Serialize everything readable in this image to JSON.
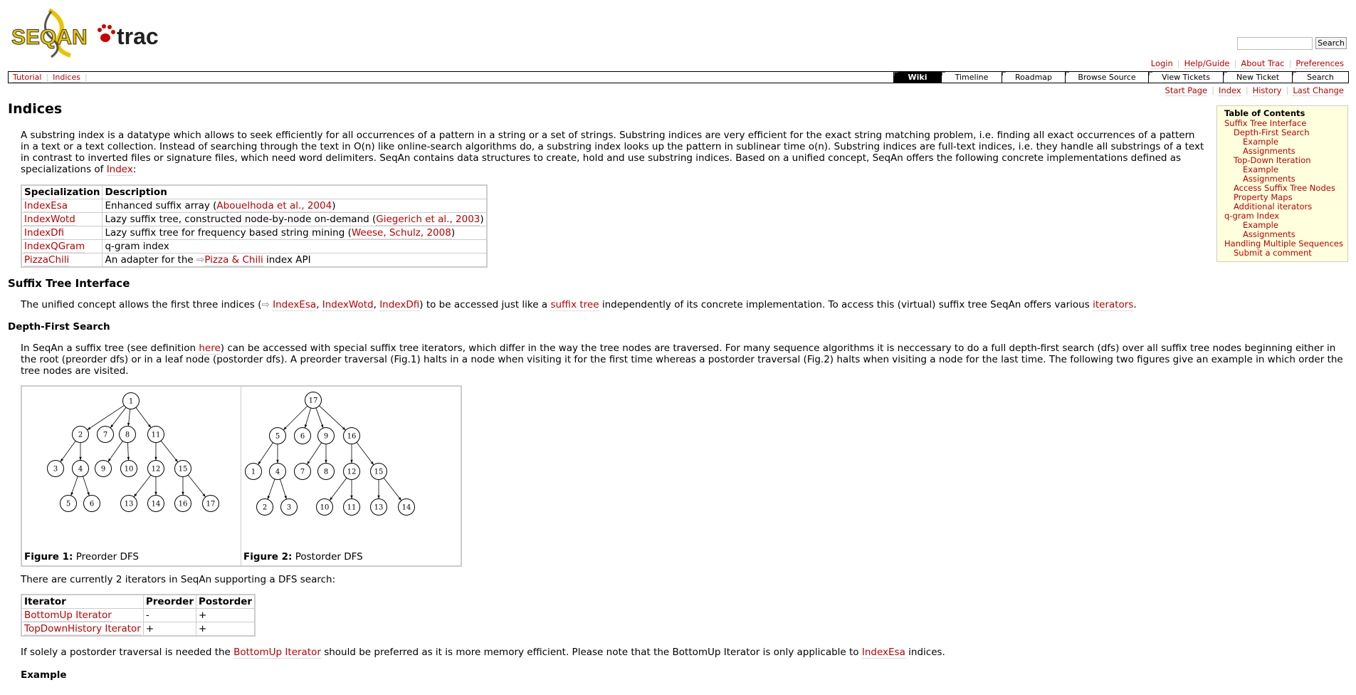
{
  "header": {
    "logo_text_seqan": "SEQAN",
    "logo_text_trac": "trac",
    "search_button": "Search"
  },
  "metanav": [
    "Login",
    "Help/Guide",
    "About Trac",
    "Preferences"
  ],
  "mainnav": {
    "left_links": [
      "Tutorial",
      "Indices"
    ],
    "tabs": [
      "Wiki",
      "Timeline",
      "Roadmap",
      "Browse Source",
      "View Tickets",
      "New Ticket",
      "Search"
    ],
    "active_tab": "Wiki"
  },
  "ctxnav": [
    "Start Page",
    "Index",
    "History",
    "Last Change"
  ],
  "page": {
    "title": "Indices",
    "intro_text": "A substring index is a datatype which allows to seek efficiently for all occurrences of a pattern in a string or a set of strings. Substring indices are very efficient for the exact string matching problem, i.e. finding all exact occurrences of a pattern in a text or a text collection. Instead of searching through the text in O(n) like online-search algorithms do, a substring index looks up the pattern in sublinear time o(n). Substring indices are full-text indices, i.e. they handle all substrings of a text in contrast to inverted files or signature files, which need word delimiters. SeqAn contains data structures to create, hold and use substring indices. Based on a unified concept, SeqAn offers the following concrete implementations defined as specializations of ",
    "intro_link": "Index",
    "intro_end": ":"
  },
  "spec_table": {
    "headers": [
      "Specialization",
      "Description"
    ],
    "rows": [
      {
        "name": "IndexEsa",
        "pre": "Enhanced suffix array (",
        "link": "Abouelhoda et al., 2004",
        "post": ")"
      },
      {
        "name": "IndexWotd",
        "pre": "Lazy suffix tree, constructed node-by-node on-demand (",
        "link": "Giegerich et al., 2003",
        "post": ")"
      },
      {
        "name": "IndexDfi",
        "pre": "Lazy suffix tree for frequency based string mining (",
        "link": "Weese, Schulz, 2008",
        "post": ")"
      },
      {
        "name": "IndexQGram",
        "pre": "q-gram index",
        "link": "",
        "post": ""
      },
      {
        "name": "PizzaChili",
        "pre": "An adapter for the ",
        "link": "Pizza & Chili",
        "post": " index API"
      }
    ]
  },
  "suffix_tree_section": {
    "heading": "Suffix Tree Interface",
    "t1": "The unified concept allows the first three indices (",
    "l1": "IndexEsa",
    "t2": ", ",
    "l2": "IndexWotd",
    "t3": ", ",
    "l3": "IndexDfi",
    "t4": ") to be accessed just like a ",
    "l4": "suffix tree",
    "t5": " independently of its concrete implementation. To access this (virtual) suffix tree SeqAn offers various ",
    "l5": "iterators",
    "t6": "."
  },
  "dfs_section": {
    "heading": "Depth-First Search",
    "t1": "In SeqAn a suffix tree (see definition ",
    "l1": "here",
    "t2": ") can be accessed with special suffix tree iterators, which differ in the way the tree nodes are traversed. For many sequence algorithms it is neccessary to do a full depth-first search (dfs) over all suffix tree nodes beginning either in the root (preorder dfs) or in a leaf node (postorder dfs). A preorder traversal (Fig.1) halts in a node when visiting it for the first time whereas a postorder traversal (Fig.2) halts when visiting a node for the last time. The following two figures give an example in which order the tree nodes are visited."
  },
  "figures": [
    {
      "label": "Figure 1:",
      "caption": " Preorder DFS",
      "nodes": [
        "1",
        "2",
        "7",
        "8",
        "11",
        "3",
        "4",
        "9",
        "10",
        "12",
        "15",
        "5",
        "6",
        "13",
        "14",
        "16",
        "17"
      ]
    },
    {
      "label": "Figure 2:",
      "caption": " Postorder DFS",
      "nodes": [
        "17",
        "5",
        "6",
        "9",
        "16",
        "1",
        "4",
        "7",
        "8",
        "12",
        "15",
        "2",
        "3",
        "10",
        "11",
        "13",
        "14"
      ]
    }
  ],
  "iterators_intro": "There are currently 2 iterators in SeqAn supporting a DFS search:",
  "iter_table": {
    "headers": [
      "Iterator",
      "Preorder",
      "Postorder"
    ],
    "rows": [
      {
        "name": "BottomUp Iterator",
        "pre": "-",
        "post": "+"
      },
      {
        "name": "TopDownHistory Iterator",
        "pre": "+",
        "post": "+"
      }
    ]
  },
  "bottomup_note": {
    "t1": "If solely a postorder traversal is needed the ",
    "l1": "BottomUp Iterator",
    "t2": " should be preferred as it is more memory efficient. Please note that the BottomUp Iterator is only applicable to ",
    "l2": "IndexEsa",
    "t3": " indices."
  },
  "example_heading": "Example",
  "toc": {
    "title": "Table of Contents",
    "items": [
      {
        "label": "Suffix Tree Interface",
        "level": 0
      },
      {
        "label": "Depth-First Search",
        "level": 1
      },
      {
        "label": "Example",
        "level": 2
      },
      {
        "label": "Assignments",
        "level": 2
      },
      {
        "label": "Top-Down Iteration",
        "level": 1
      },
      {
        "label": "Example",
        "level": 2
      },
      {
        "label": "Assignments",
        "level": 2
      },
      {
        "label": "Access Suffix Tree Nodes",
        "level": 1
      },
      {
        "label": "Property Maps",
        "level": 1
      },
      {
        "label": "Additional iterators",
        "level": 1
      },
      {
        "label": "q-gram Index",
        "level": 0
      },
      {
        "label": "Example",
        "level": 2
      },
      {
        "label": "Assignments",
        "level": 2
      },
      {
        "label": "Handling Multiple Sequences",
        "level": 0
      },
      {
        "label": "Submit a comment",
        "level": 1
      }
    ]
  }
}
